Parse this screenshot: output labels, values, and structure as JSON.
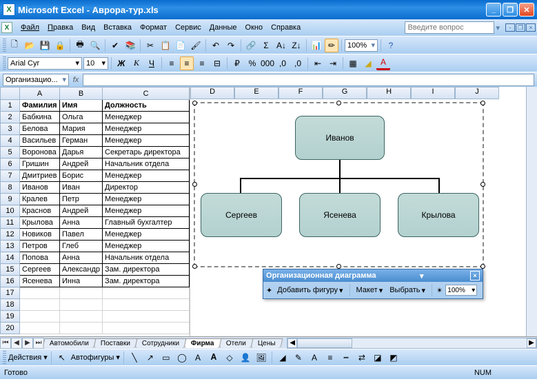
{
  "window": {
    "app": "Microsoft Excel",
    "doc": "Аврора-тур.xls"
  },
  "menu": {
    "file": "Файл",
    "edit": "Правка",
    "view": "Вид",
    "insert": "Вставка",
    "format": "Формат",
    "tools": "Сервис",
    "data": "Данные",
    "window": "Окно",
    "help": "Справка",
    "ask_placeholder": "Введите вопрос"
  },
  "toolbar": {
    "zoom": "100%"
  },
  "format": {
    "font": "Arial Cyr",
    "size": "10"
  },
  "formula": {
    "name": "Организацио..."
  },
  "headers": [
    "A",
    "B",
    "C",
    "D",
    "E",
    "F",
    "G",
    "H",
    "I",
    "J"
  ],
  "table": {
    "cols": [
      "Фамилия",
      "Имя",
      "Должность"
    ],
    "rows": [
      [
        "Бабкина",
        "Ольга",
        "Менеджер"
      ],
      [
        "Белова",
        "Мария",
        "Менеджер"
      ],
      [
        "Васильев",
        "Герман",
        "Менеджер"
      ],
      [
        "Воронова",
        "Дарья",
        "Секретарь директора"
      ],
      [
        "Гришин",
        "Андрей",
        "Начальник отдела"
      ],
      [
        "Дмитриев",
        "Борис",
        "Менеджер"
      ],
      [
        "Иванов",
        "Иван",
        "Директор"
      ],
      [
        "Кралев",
        "Петр",
        "Менеджер"
      ],
      [
        "Краснов",
        "Андрей",
        "Менеджер"
      ],
      [
        "Крылова",
        "Анна",
        "Главный бухгалтер"
      ],
      [
        "Новиков",
        "Павел",
        "Менеджер"
      ],
      [
        "Петров",
        "Глеб",
        "Менеджер"
      ],
      [
        "Попова",
        "Анна",
        "Начальник отдела"
      ],
      [
        "Сергеев",
        "Александр",
        "Зам. директора"
      ],
      [
        "Ясенева",
        "Инна",
        "Зам. директора"
      ]
    ]
  },
  "chart_data": {
    "type": "org-chart",
    "root": "Иванов",
    "children": [
      "Сергеев",
      "Ясенева",
      "Крылова"
    ]
  },
  "orgfloat": {
    "title": "Организационная диаграмма",
    "add": "Добавить фигуру",
    "layout": "Макет",
    "select": "Выбрать",
    "zoom": "100%"
  },
  "sheets": {
    "tabs": [
      "Автомобили",
      "Поставки",
      "Сотрудники",
      "Фирма",
      "Отели",
      "Цены"
    ],
    "active": 3
  },
  "drawbar": {
    "actions": "Действия",
    "autoshapes": "Автофигуры"
  },
  "status": {
    "ready": "Готово",
    "num": "NUM"
  }
}
